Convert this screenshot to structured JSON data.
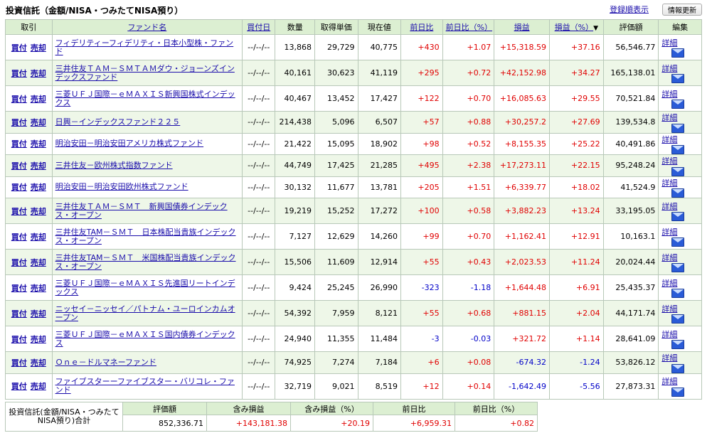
{
  "header": {
    "title": "投資信託（金額/NISA・つみたてNISA預り）",
    "register_link": "登録順表示",
    "update_button": "情報更新"
  },
  "columns": {
    "trade": "取引",
    "fund_name": "ファンド名",
    "buy_date": "買付日",
    "quantity": "数量",
    "acq_price": "取得単価",
    "current_price": "現在値",
    "day_change": "前日比",
    "day_change_pct": "前日比（%）",
    "pnl": "損益",
    "pnl_pct": "損益（%）",
    "pnl_pct_sort": "▼",
    "valuation": "評価額",
    "edit": "編集"
  },
  "actions": {
    "buy": "買付",
    "sell": "売却",
    "detail": "詳細"
  },
  "colors": {
    "positive": "#e00000",
    "negative": "#0000c8",
    "header_bg": "#dcefd2",
    "row_alt_bg": "#eef7e8"
  },
  "rows": [
    {
      "fund": "フィデリティーフィデリティ・日本小型株・ファンド",
      "date": "--/--/--",
      "qty": "13,868",
      "acq": "29,729",
      "cur": "40,775",
      "day": "+430",
      "day_pct": "+1.07",
      "pnl": "+15,318.59",
      "pnl_pct": "+37.16",
      "val": "56,546.77",
      "sign": "pos"
    },
    {
      "fund": "三井住友ＴＡＭ－ＳＭＴＡＭダウ・ジョーンズインデックスファンド",
      "date": "--/--/--",
      "qty": "40,161",
      "acq": "30,623",
      "cur": "41,119",
      "day": "+295",
      "day_pct": "+0.72",
      "pnl": "+42,152.98",
      "pnl_pct": "+34.27",
      "val": "165,138.01",
      "sign": "pos"
    },
    {
      "fund": "三菱ＵＦＪ国際－ｅＭＡＸＩＳ新興国株式インデックス",
      "date": "--/--/--",
      "qty": "40,467",
      "acq": "13,452",
      "cur": "17,427",
      "day": "+122",
      "day_pct": "+0.70",
      "pnl": "+16,085.63",
      "pnl_pct": "+29.55",
      "val": "70,521.84",
      "sign": "pos"
    },
    {
      "fund": "日興－インデックスファンド２２５",
      "date": "--/--/--",
      "qty": "214,438",
      "acq": "5,096",
      "cur": "6,507",
      "day": "+57",
      "day_pct": "+0.88",
      "pnl": "+30,257.2",
      "pnl_pct": "+27.69",
      "val": "139,534.8",
      "sign": "pos"
    },
    {
      "fund": "明治安田－明治安田アメリカ株式ファンド",
      "date": "--/--/--",
      "qty": "21,422",
      "acq": "15,095",
      "cur": "18,902",
      "day": "+98",
      "day_pct": "+0.52",
      "pnl": "+8,155.35",
      "pnl_pct": "+25.22",
      "val": "40,491.86",
      "sign": "pos"
    },
    {
      "fund": "三井住友－欧州株式指数ファンド",
      "date": "--/--/--",
      "qty": "44,749",
      "acq": "17,425",
      "cur": "21,285",
      "day": "+495",
      "day_pct": "+2.38",
      "pnl": "+17,273.11",
      "pnl_pct": "+22.15",
      "val": "95,248.24",
      "sign": "pos"
    },
    {
      "fund": "明治安田－明治安田欧州株式ファンド",
      "date": "--/--/--",
      "qty": "30,132",
      "acq": "11,677",
      "cur": "13,781",
      "day": "+205",
      "day_pct": "+1.51",
      "pnl": "+6,339.77",
      "pnl_pct": "+18.02",
      "val": "41,524.9",
      "sign": "pos"
    },
    {
      "fund": "三井住友ＴＡＭ－ＳＭＴ　新興国債券インデックス・オープン",
      "date": "--/--/--",
      "qty": "19,219",
      "acq": "15,252",
      "cur": "17,272",
      "day": "+100",
      "day_pct": "+0.58",
      "pnl": "+3,882.23",
      "pnl_pct": "+13.24",
      "val": "33,195.05",
      "sign": "pos"
    },
    {
      "fund": "三井住友TAM－ＳＭＴ　日本株配当貴族インデックス・オープン",
      "date": "--/--/--",
      "qty": "7,127",
      "acq": "12,629",
      "cur": "14,260",
      "day": "+99",
      "day_pct": "+0.70",
      "pnl": "+1,162.41",
      "pnl_pct": "+12.91",
      "val": "10,163.1",
      "sign": "pos"
    },
    {
      "fund": "三井住友TAM－ＳＭＴ　米国株配当貴族インデックス・オープン",
      "date": "--/--/--",
      "qty": "15,506",
      "acq": "11,609",
      "cur": "12,914",
      "day": "+55",
      "day_pct": "+0.43",
      "pnl": "+2,023.53",
      "pnl_pct": "+11.24",
      "val": "20,024.44",
      "sign": "pos"
    },
    {
      "fund": "三菱ＵＦＪ国際－ｅＭＡＸＩＳ先進国リートインデックス",
      "date": "--/--/--",
      "qty": "9,424",
      "acq": "25,245",
      "cur": "26,990",
      "day": "-323",
      "day_pct": "-1.18",
      "pnl": "+1,644.48",
      "pnl_pct": "+6.91",
      "val": "25,435.37",
      "sign": "mixed"
    },
    {
      "fund": "ニッセイ－ニッセイ／パトナム・ユーロインカムオープン",
      "date": "--/--/--",
      "qty": "54,392",
      "acq": "7,959",
      "cur": "8,121",
      "day": "+55",
      "day_pct": "+0.68",
      "pnl": "+881.15",
      "pnl_pct": "+2.04",
      "val": "44,171.74",
      "sign": "pos"
    },
    {
      "fund": "三菱ＵＦＪ国際－ｅＭＡＸＩＳ国内債券インデックス",
      "date": "--/--/--",
      "qty": "24,940",
      "acq": "11,355",
      "cur": "11,484",
      "day": "-3",
      "day_pct": "-0.03",
      "pnl": "+321.72",
      "pnl_pct": "+1.14",
      "val": "28,641.09",
      "sign": "mixed"
    },
    {
      "fund": "Ｏｎｅ－ドルマネーファンド",
      "date": "--/--/--",
      "qty": "74,925",
      "acq": "7,274",
      "cur": "7,184",
      "day": "+6",
      "day_pct": "+0.08",
      "pnl": "-674.32",
      "pnl_pct": "-1.24",
      "val": "53,826.12",
      "sign": "mixed2"
    },
    {
      "fund": "ファイブスターーファイブスター・バリコレ・ファンド",
      "date": "--/--/--",
      "qty": "32,719",
      "acq": "9,021",
      "cur": "8,519",
      "day": "+12",
      "day_pct": "+0.14",
      "pnl": "-1,642.49",
      "pnl_pct": "-5.56",
      "val": "27,873.31",
      "sign": "mixed2"
    }
  ],
  "summary": {
    "label": "投資信託(金額/NISA・つみたてNISA預り)合計",
    "headers": [
      "評価額",
      "含み損益",
      "含み損益（%）",
      "前日比",
      "前日比（%）"
    ],
    "values": [
      "852,336.71",
      "+143,181.38",
      "+20.19",
      "+6,959.31",
      "+0.82"
    ]
  }
}
